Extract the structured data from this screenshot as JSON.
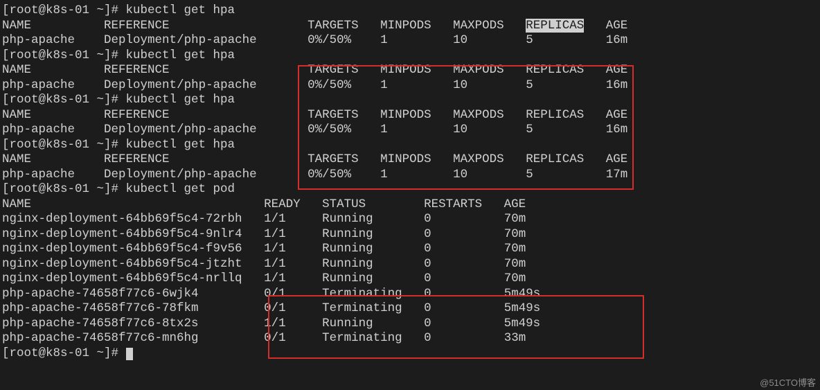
{
  "prompt": "[root@k8s-01 ~]# ",
  "cmd_hpa": "kubectl get hpa",
  "cmd_pod": "kubectl get pod",
  "hpa_hdr": {
    "name": "NAME",
    "ref": "REFERENCE",
    "tgt": "TARGETS",
    "min": "MINPODS",
    "max": "MAXPODS",
    "rep": "REPLICAS",
    "age": "AGE"
  },
  "hpa_row": {
    "name": "php-apache",
    "ref": "Deployment/php-apache",
    "tgt": "0%/50%",
    "min": "1",
    "max": "10",
    "rep": "5"
  },
  "hpa_age": {
    "a16": "16m",
    "a17": "17m"
  },
  "pod_hdr": {
    "name": "NAME",
    "ready": "READY",
    "status": "STATUS",
    "restarts": "RESTARTS",
    "age": "AGE"
  },
  "pods": {
    "p0": {
      "name": "nginx-deployment-64bb69f5c4-72rbh",
      "ready": "1/1",
      "status": "Running",
      "restarts": "0",
      "age": "70m"
    },
    "p1": {
      "name": "nginx-deployment-64bb69f5c4-9nlr4",
      "ready": "1/1",
      "status": "Running",
      "restarts": "0",
      "age": "70m"
    },
    "p2": {
      "name": "nginx-deployment-64bb69f5c4-f9v56",
      "ready": "1/1",
      "status": "Running",
      "restarts": "0",
      "age": "70m"
    },
    "p3": {
      "name": "nginx-deployment-64bb69f5c4-jtzht",
      "ready": "1/1",
      "status": "Running",
      "restarts": "0",
      "age": "70m"
    },
    "p4": {
      "name": "nginx-deployment-64bb69f5c4-nrllq",
      "ready": "1/1",
      "status": "Running",
      "restarts": "0",
      "age": "70m"
    },
    "p5": {
      "name": "php-apache-74658f77c6-6wjk4",
      "ready": "0/1",
      "status": "Terminating",
      "restarts": "0",
      "age": "5m49s"
    },
    "p6": {
      "name": "php-apache-74658f77c6-78fkm",
      "ready": "0/1",
      "status": "Terminating",
      "restarts": "0",
      "age": "5m49s"
    },
    "p7": {
      "name": "php-apache-74658f77c6-8tx2s",
      "ready": "1/1",
      "status": "Running",
      "restarts": "0",
      "age": "5m49s"
    },
    "p8": {
      "name": "php-apache-74658f77c6-mn6hg",
      "ready": "0/1",
      "status": "Terminating",
      "restarts": "0",
      "age": "33m"
    }
  },
  "watermark": "@51CTO博客"
}
